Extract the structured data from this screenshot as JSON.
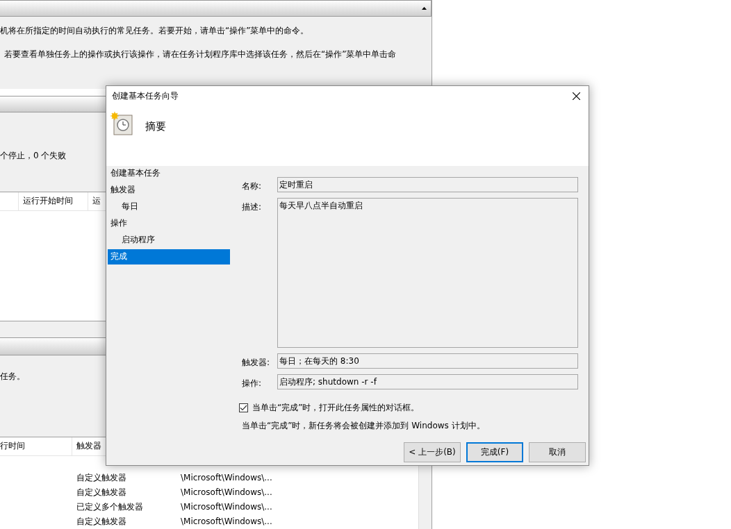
{
  "background": {
    "intro_lines": [
      "机将在所指定的时间自动执行的常见任务。若要开始，请单击“操作”菜单中的命令。",
      "若要查看单独任务上的操作或执行该操作，请在任务计划程序库中选择该任务，然后在“操作”菜单中单击命"
    ],
    "status_text": "个停止，0 个失败",
    "run_table": {
      "columns": [
        "运行开始时间",
        "运"
      ]
    },
    "active_text": "任务。",
    "task_table": {
      "columns": [
        "行时间",
        "触发器"
      ],
      "rows": [
        {
          "trigger": "自定义触发器",
          "column_3": "\\Microsoft\\Windows\\..."
        },
        {
          "trigger": "自定义触发器",
          "column_3": "\\Microsoft\\Windows\\..."
        },
        {
          "trigger": "已定义多个触发器",
          "column_3": "\\Microsoft\\Windows\\..."
        },
        {
          "trigger": "自定义触发器",
          "column_3": "\\Microsoft\\Windows\\..."
        }
      ]
    }
  },
  "dialog": {
    "title": "创建基本任务向导",
    "heading": "摘要",
    "steps": [
      {
        "label": "创建基本任务",
        "selected": false
      },
      {
        "label": "触发器",
        "selected": false,
        "children": [
          {
            "label": "每日",
            "selected": false
          }
        ]
      },
      {
        "label": "操作",
        "selected": false,
        "children": [
          {
            "label": "启动程序",
            "selected": false
          }
        ]
      },
      {
        "label": "完成",
        "selected": true
      }
    ],
    "fields": [
      {
        "kind": "line",
        "label": "名称:",
        "value": "定时重启"
      },
      {
        "kind": "area",
        "label": "描述:",
        "value": "每天早八点半自动重启"
      },
      {
        "kind": "line",
        "label": "触发器:",
        "value": "每日；在每天的 8:30"
      },
      {
        "kind": "line",
        "label": "操作:",
        "value": "启动程序; shutdown -r -f"
      }
    ],
    "open_properties": {
      "label": "当单击“完成”时，打开此任务属性的对话框。",
      "checked": true
    },
    "note": "当单击“完成”时，新任务将会被创建并添加到 Windows 计划中。",
    "buttons": [
      {
        "label": "< 上一步(B)",
        "default": false
      },
      {
        "label": "完成(F)",
        "default": true
      },
      {
        "label": "取消",
        "default": false
      }
    ]
  }
}
